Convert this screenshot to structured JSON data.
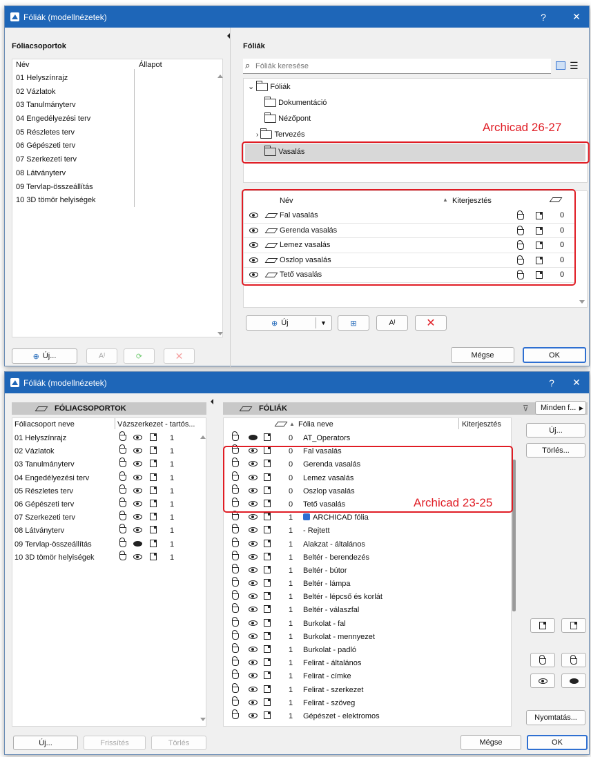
{
  "top": {
    "title": "Fóliák (modellnézetek)",
    "help": "?",
    "close": "✕",
    "left_header": "Fóliacsoportok",
    "col_name": "Név",
    "col_state": "Állapot",
    "groups": [
      "01 Helyszínrajz",
      "02 Vázlatok",
      "03 Tanulmányterv",
      "04 Engedélyezési terv",
      "05 Részletes terv",
      "06 Gépészeti terv",
      "07 Szerkezeti terv",
      "08 Látványterv",
      "09 Tervlap-összeállítás",
      "10 3D tömör helyiségek"
    ],
    "right_header": "Fóliák",
    "search_placeholder": "Fóliák keresése",
    "tree": {
      "root": "Fóliák",
      "folders": [
        "Dokumentáció",
        "Nézőpont",
        "Tervezés",
        "Vasalás"
      ]
    },
    "annotation": "Archicad 26-27",
    "layer_col_name": "Név",
    "layer_col_ext": "Kiterjesztés",
    "layers": [
      {
        "name": "Fal vasalás",
        "num": "0"
      },
      {
        "name": "Gerenda vasalás",
        "num": "0"
      },
      {
        "name": "Lemez vasalás",
        "num": "0"
      },
      {
        "name": "Oszlop vasalás",
        "num": "0"
      },
      {
        "name": "Tető vasalás",
        "num": "0"
      }
    ],
    "new_label": "Új",
    "new_left_label": "Új...",
    "cancel": "Mégse",
    "ok": "OK",
    "text_icon": "Aᴵ"
  },
  "bottom": {
    "title": "Fóliák (modellnézetek)",
    "help": "?",
    "close": "✕",
    "left_section": "FÓLIACSOPORTOK",
    "col_group_name": "Fóliacsoport neve",
    "col_wire": "Vázszerkezet - tartós...",
    "groups": [
      {
        "name": "01 Helyszínrajz",
        "n": "1",
        "fill": false
      },
      {
        "name": "02 Vázlatok",
        "n": "1",
        "fill": false
      },
      {
        "name": "03 Tanulmányterv",
        "n": "1",
        "fill": false
      },
      {
        "name": "04 Engedélyezési terv",
        "n": "1",
        "fill": false
      },
      {
        "name": "05 Részletes terv",
        "n": "1",
        "fill": false
      },
      {
        "name": "06 Gépészeti terv",
        "n": "1",
        "fill": false
      },
      {
        "name": "07 Szerkezeti terv",
        "n": "1",
        "fill": false
      },
      {
        "name": "08 Látványterv",
        "n": "1",
        "fill": false
      },
      {
        "name": "09 Tervlap-összeállítás",
        "n": "1",
        "fill": true
      },
      {
        "name": "10 3D tömör helyiségek",
        "n": "1",
        "fill": false
      }
    ],
    "right_section": "FÓLIÁK",
    "col_layer_name": "Fólia neve",
    "col_ext": "Kiterjesztés",
    "filter": "Minden f...",
    "layers": [
      {
        "n": "0",
        "name": "AT_Operators"
      },
      {
        "n": "0",
        "name": "Fal vasalás"
      },
      {
        "n": "0",
        "name": "Gerenda vasalás"
      },
      {
        "n": "0",
        "name": "Lemez vasalás"
      },
      {
        "n": "0",
        "name": "Oszlop vasalás"
      },
      {
        "n": "0",
        "name": "Tető vasalás"
      },
      {
        "n": "1",
        "name": "ARCHICAD fólia"
      },
      {
        "n": "1",
        "name": "- Rejtett"
      },
      {
        "n": "1",
        "name": "Alakzat - általános"
      },
      {
        "n": "1",
        "name": "Beltér - berendezés"
      },
      {
        "n": "1",
        "name": "Beltér - bútor"
      },
      {
        "n": "1",
        "name": "Beltér - lámpa"
      },
      {
        "n": "1",
        "name": "Beltér - lépcső és korlát"
      },
      {
        "n": "1",
        "name": "Beltér - válaszfal"
      },
      {
        "n": "1",
        "name": "Burkolat - fal"
      },
      {
        "n": "1",
        "name": "Burkolat - mennyezet"
      },
      {
        "n": "1",
        "name": "Burkolat - padló"
      },
      {
        "n": "1",
        "name": "Felirat - általános"
      },
      {
        "n": "1",
        "name": "Felirat - címke"
      },
      {
        "n": "1",
        "name": "Felirat - szerkezet"
      },
      {
        "n": "1",
        "name": "Felirat - szöveg"
      },
      {
        "n": "1",
        "name": "Gépészet - elektromos"
      }
    ],
    "annotation": "Archicad 23-25",
    "new_btn": "Új...",
    "delete_btn": "Törlés...",
    "print_btn": "Nyomtatás...",
    "left_new": "Új...",
    "left_refresh": "Frissítés",
    "left_delete": "Törlés",
    "cancel": "Mégse",
    "ok": "OK"
  }
}
